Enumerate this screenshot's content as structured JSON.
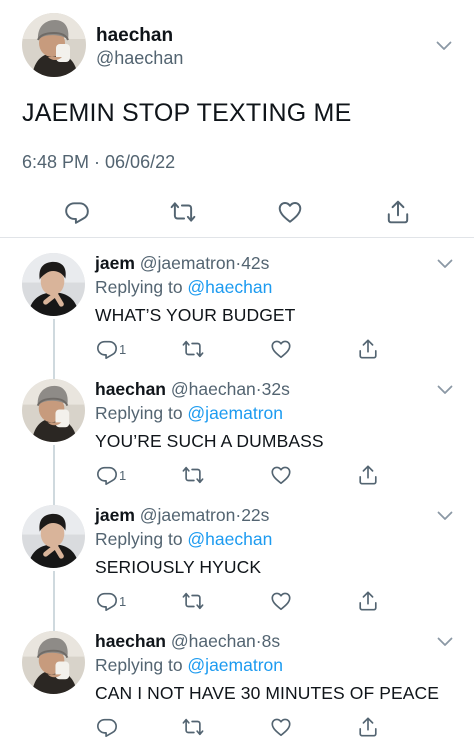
{
  "main_tweet": {
    "name": "haechan",
    "handle": "@haechan",
    "text": "JAEMIN STOP TEXTING ME",
    "timestamp": "6:48 PM · 06/06/22",
    "avatar": "haechan-avatar",
    "actions": [
      "reply-icon",
      "retweet-icon",
      "like-icon",
      "share-icon"
    ]
  },
  "replies": [
    {
      "name": "jaem",
      "handle": "@jaematron",
      "dot": "·",
      "time": "42s",
      "replying_prefix": "Replying to ",
      "replying_to": "@haechan",
      "text": "WHAT’S YOUR BUDGET",
      "reply_count": "1",
      "avatar": "jaem-avatar"
    },
    {
      "name": "haechan",
      "handle": "@haechan",
      "dot": "·",
      "time": "32s",
      "replying_prefix": "Replying to ",
      "replying_to": "@jaematron",
      "text": "YOU’RE SUCH A DUMBASS",
      "reply_count": "1",
      "avatar": "haechan-avatar"
    },
    {
      "name": "jaem",
      "handle": "@jaematron",
      "dot": "·",
      "time": "22s",
      "replying_prefix": "Replying to ",
      "replying_to": "@haechan",
      "text": "SERIOUSLY HYUCK",
      "reply_count": "1",
      "avatar": "jaem-avatar"
    },
    {
      "name": "haechan",
      "handle": "@haechan",
      "dot": "·",
      "time": "8s",
      "replying_prefix": "Replying to ",
      "replying_to": "@jaematron",
      "text": "CAN I NOT HAVE 30 MINUTES OF PEACE",
      "reply_count": "",
      "avatar": "haechan-avatar"
    }
  ],
  "colors": {
    "text": "#0f1419",
    "secondary": "#536471",
    "accent": "#1d9bf0",
    "divider": "#e1e4e8",
    "thread_line": "#cfd9de"
  }
}
